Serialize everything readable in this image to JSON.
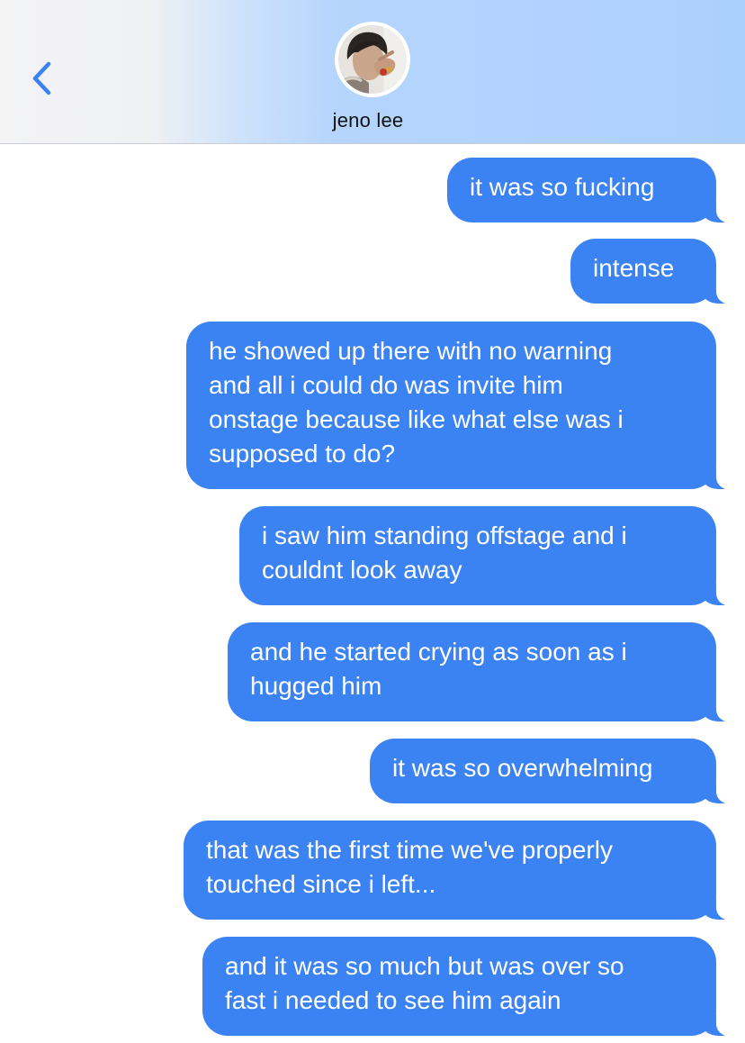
{
  "header": {
    "contact_name": "jeno lee",
    "back_icon": "chevron-left-icon",
    "accent_color": "#3a82f2"
  },
  "messages": [
    {
      "text": "it was so fucking",
      "from": "me"
    },
    {
      "text": "intense",
      "from": "me"
    },
    {
      "text": "he showed up there with no warning\nand all i could do was invite him\nonstage because like what else was i\nsupposed to do?",
      "from": "me"
    },
    {
      "text": "i saw him standing offstage and i\ncouldnt look away",
      "from": "me"
    },
    {
      "text": "and he started crying as soon as i\nhugged him",
      "from": "me"
    },
    {
      "text": "it was so overwhelming",
      "from": "me"
    },
    {
      "text": "that was the first time we've properly\ntouched since i left...",
      "from": "me"
    },
    {
      "text": "and it was so much but was over so\nfast i needed to see him again",
      "from": "me"
    }
  ],
  "colors": {
    "bubble": "#3b82f2",
    "bubble_text": "#ffffff"
  }
}
